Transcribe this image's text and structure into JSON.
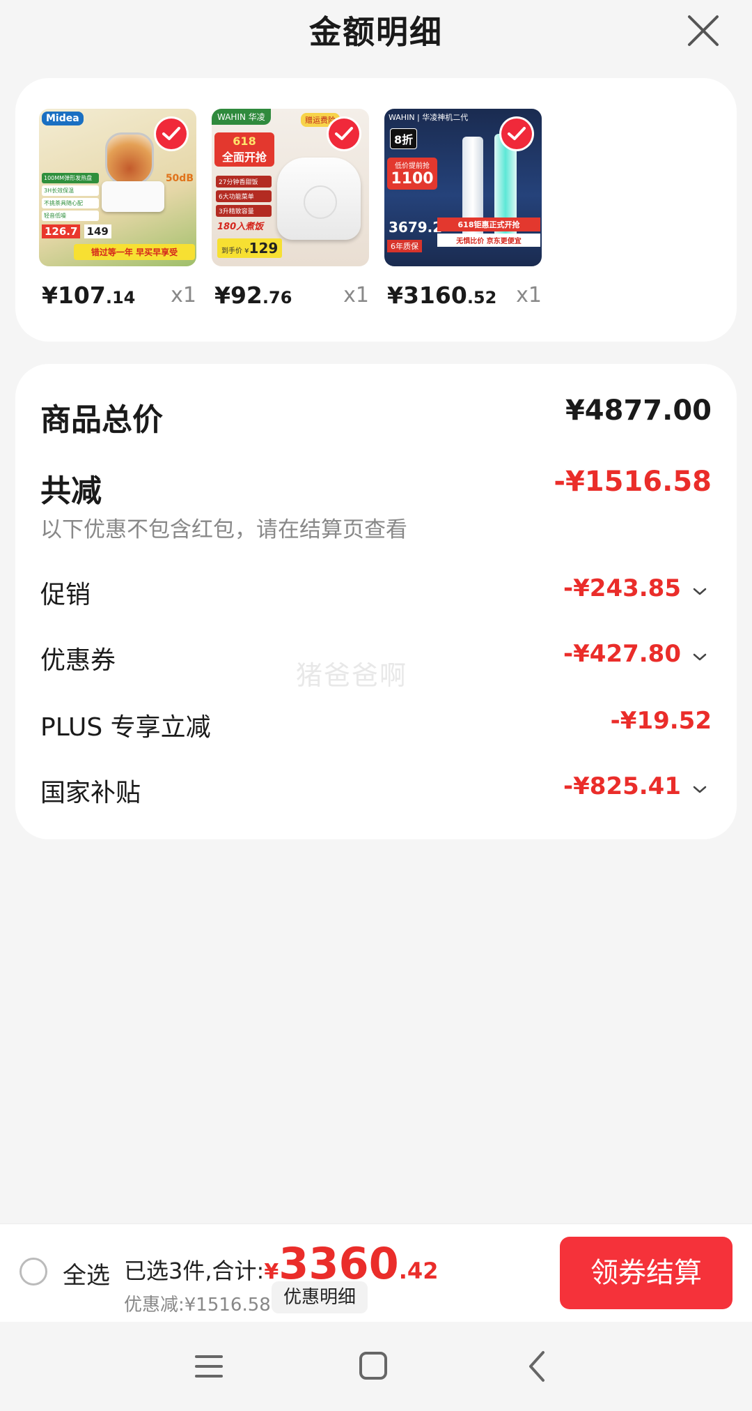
{
  "header": {
    "title": "金额明细"
  },
  "products": [
    {
      "price_int": "¥107",
      "price_dec": ".14",
      "qty": "x1",
      "colors": {
        "bg1": "#e9e1c7",
        "bg2": "#b9c98a"
      },
      "thumb": {
        "brand": "Midea",
        "tags": [
          "100MM弹形发热盘",
          "3H长效保温",
          "不挑茶具随心配",
          "轻音低噪"
        ],
        "db": "50dB",
        "p1": "126.7",
        "p2": "149",
        "slogan": "错过等一年 早买早享受"
      }
    },
    {
      "price_int": "¥92",
      "price_dec": ".76",
      "qty": "x1",
      "colors": {
        "bg1": "#efe8e1",
        "bg2": "#d9c9b9"
      },
      "thumb": {
        "brand": "WAHIN 华凌",
        "badge": "618",
        "headline": "全面开抢",
        "tags": [
          "27分钟香甜饭",
          "6大功能菜单",
          "3升精致容量"
        ],
        "tagline": "180入煮饭",
        "promo": "赠运费险",
        "final_label": "到手价 ¥",
        "final": "129"
      }
    },
    {
      "price_int": "¥3160",
      "price_dec": ".52",
      "qty": "x1",
      "colors": {
        "bg1": "#1d2e57",
        "bg2": "#2c4d8a"
      },
      "thumb": {
        "brand": "WAHIN | 华凌神机二代",
        "discount": "8折",
        "promo": "低价提前抢",
        "p1": "1100",
        "p2": "3679.2",
        "warranty": "6年质保",
        "banner1": "618钜惠正式开抢",
        "banner2": "无惧比价 京东更便宜"
      }
    }
  ],
  "summary": {
    "total_label": "商品总价",
    "total_value": "¥4877.00",
    "reduce_label": "共减",
    "reduce_value": "-¥1516.58",
    "note": "以下优惠不包含红包，请在结算页查看",
    "items": [
      {
        "label": "促销",
        "value": "-¥243.85",
        "expandable": true
      },
      {
        "label": "优惠券",
        "value": "-¥427.80",
        "expandable": true
      },
      {
        "label": "PLUS 专享立减",
        "value": "-¥19.52",
        "expandable": false
      },
      {
        "label": "国家补贴",
        "value": "-¥825.41",
        "expandable": true
      }
    ]
  },
  "watermark": "猪爸爸啊",
  "footer": {
    "select_all": "全选",
    "selected_text": "已选3件,合计:",
    "currency": "¥",
    "total_int": "3360",
    "total_dec": ".42",
    "discount_text": "优惠减:¥1516.58",
    "detail_button": "优惠明细",
    "pay_button": "领券结算"
  },
  "colors": {
    "accent": "#ea2d2a",
    "button": "#f5323a",
    "background": "#f5f5f5"
  },
  "navbar": {
    "icons": [
      "menu-icon",
      "home-icon",
      "back-icon"
    ]
  }
}
